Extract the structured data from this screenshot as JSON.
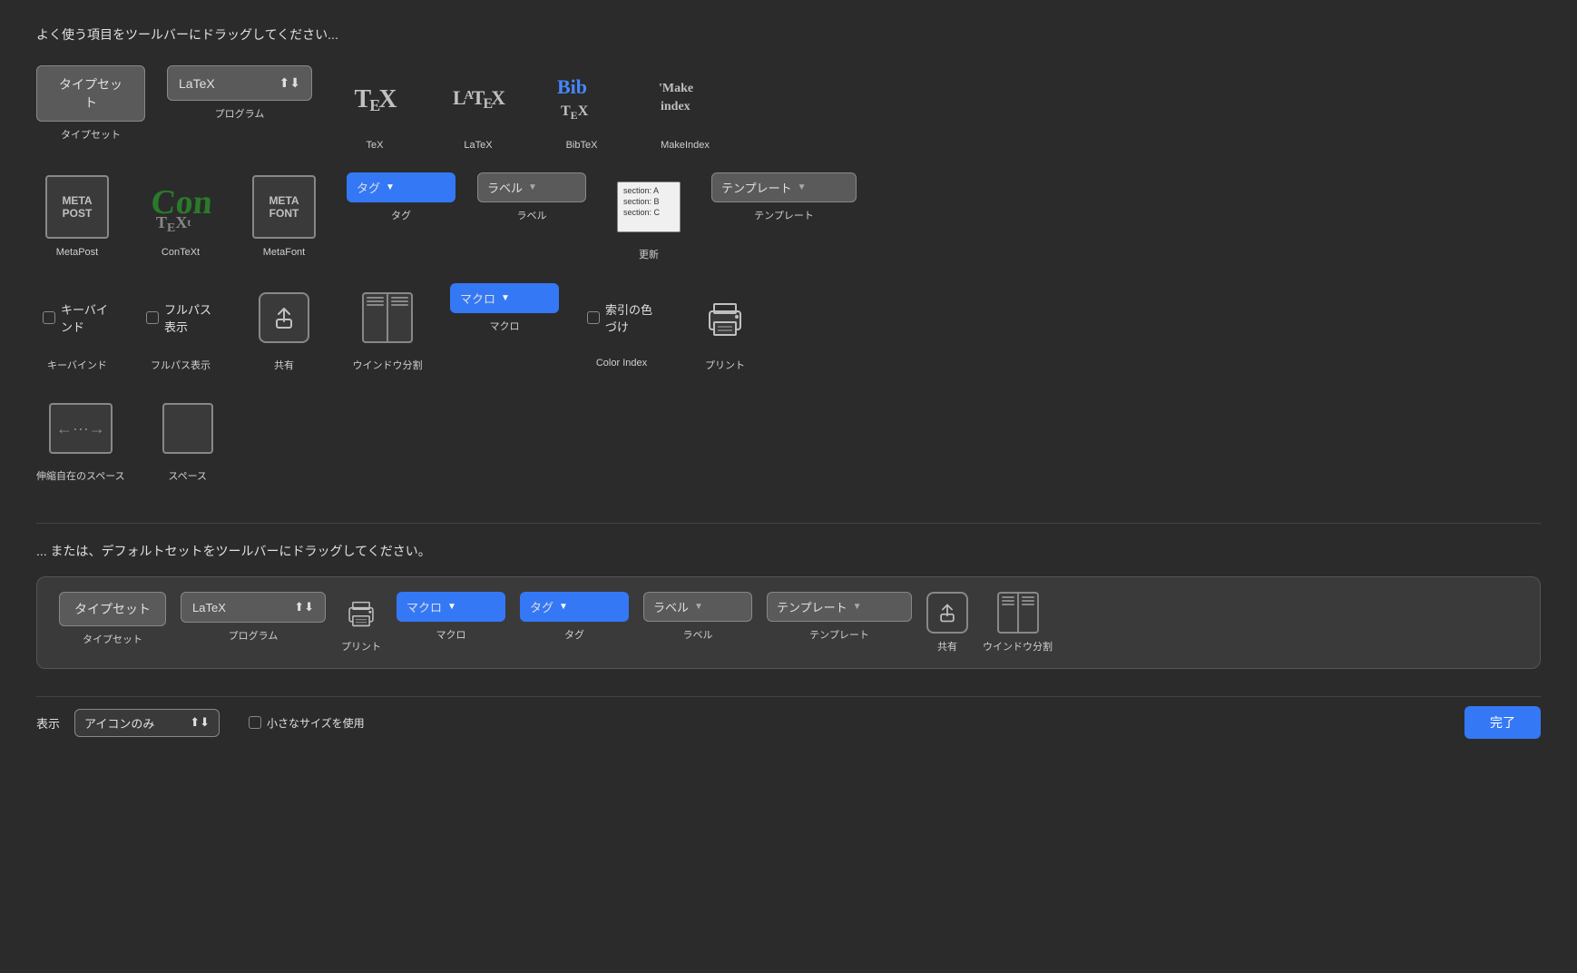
{
  "header": {
    "drag_hint": "よく使う項目をツールバーにドラッグしてください...",
    "default_hint": "... または、デフォルトセットをツールバーにドラッグしてください。"
  },
  "toolbar_items": [
    {
      "id": "typeset",
      "label": "タイプセット",
      "type": "button"
    },
    {
      "id": "program",
      "label": "プログラム",
      "type": "dropdown",
      "value": "LaTeX"
    },
    {
      "id": "tex",
      "label": "TeX",
      "type": "icon"
    },
    {
      "id": "latex",
      "label": "LaTeX",
      "type": "icon"
    },
    {
      "id": "bibtex",
      "label": "BibTeX",
      "type": "icon"
    },
    {
      "id": "makeindex",
      "label": "MakeIndex",
      "type": "icon"
    },
    {
      "id": "metapost",
      "label": "MetaPost",
      "type": "icon"
    },
    {
      "id": "context",
      "label": "ConTeXt",
      "type": "icon"
    },
    {
      "id": "metafont",
      "label": "MetaFont",
      "type": "icon"
    },
    {
      "id": "tag",
      "label": "タグ",
      "type": "dropdown",
      "value": "タグ"
    },
    {
      "id": "label",
      "label": "ラベル",
      "type": "dropdown",
      "value": "ラベル"
    },
    {
      "id": "update",
      "label": "更新",
      "type": "icon"
    },
    {
      "id": "template",
      "label": "テンプレート",
      "type": "dropdown",
      "value": "テンプレート"
    },
    {
      "id": "keybind",
      "label": "キーバインド",
      "type": "checkbox"
    },
    {
      "id": "fullpath",
      "label": "フルパス表示",
      "type": "checkbox"
    },
    {
      "id": "share",
      "label": "共有",
      "type": "icon"
    },
    {
      "id": "window_split",
      "label": "ウインドウ分割",
      "type": "icon"
    },
    {
      "id": "macro",
      "label": "マクロ",
      "type": "dropdown",
      "value": "マクロ"
    },
    {
      "id": "color_index",
      "label": "Color Index",
      "type": "checkbox",
      "label_ja": "索引の色づけ"
    },
    {
      "id": "print",
      "label": "プリント",
      "type": "icon"
    },
    {
      "id": "flexible_space",
      "label": "伸縮自在のスペース",
      "type": "icon"
    },
    {
      "id": "space",
      "label": "スペース",
      "type": "icon"
    }
  ],
  "default_bar": {
    "items": [
      {
        "id": "typeset",
        "label": "タイプセット",
        "type": "button"
      },
      {
        "id": "program",
        "label": "プログラム",
        "type": "dropdown",
        "value": "LaTeX"
      },
      {
        "id": "print",
        "label": "プリント",
        "type": "icon"
      },
      {
        "id": "macro",
        "label": "マクロ",
        "type": "dropdown",
        "value": "マクロ"
      },
      {
        "id": "tag",
        "label": "タグ",
        "type": "dropdown",
        "value": "タグ"
      },
      {
        "id": "label",
        "label": "ラベル",
        "type": "dropdown",
        "value": "ラベル"
      },
      {
        "id": "template",
        "label": "テンプレート",
        "type": "dropdown",
        "value": "テンプレート"
      },
      {
        "id": "share",
        "label": "共有",
        "type": "icon"
      },
      {
        "id": "window_split",
        "label": "ウインドウ分割",
        "type": "icon"
      }
    ]
  },
  "bottom_bar": {
    "display_label": "表示",
    "display_value": "アイコンのみ",
    "small_size_label": "小さなサイズを使用",
    "done_label": "完了"
  },
  "update_lines": [
    "section: A",
    "section: B",
    "section: C"
  ]
}
